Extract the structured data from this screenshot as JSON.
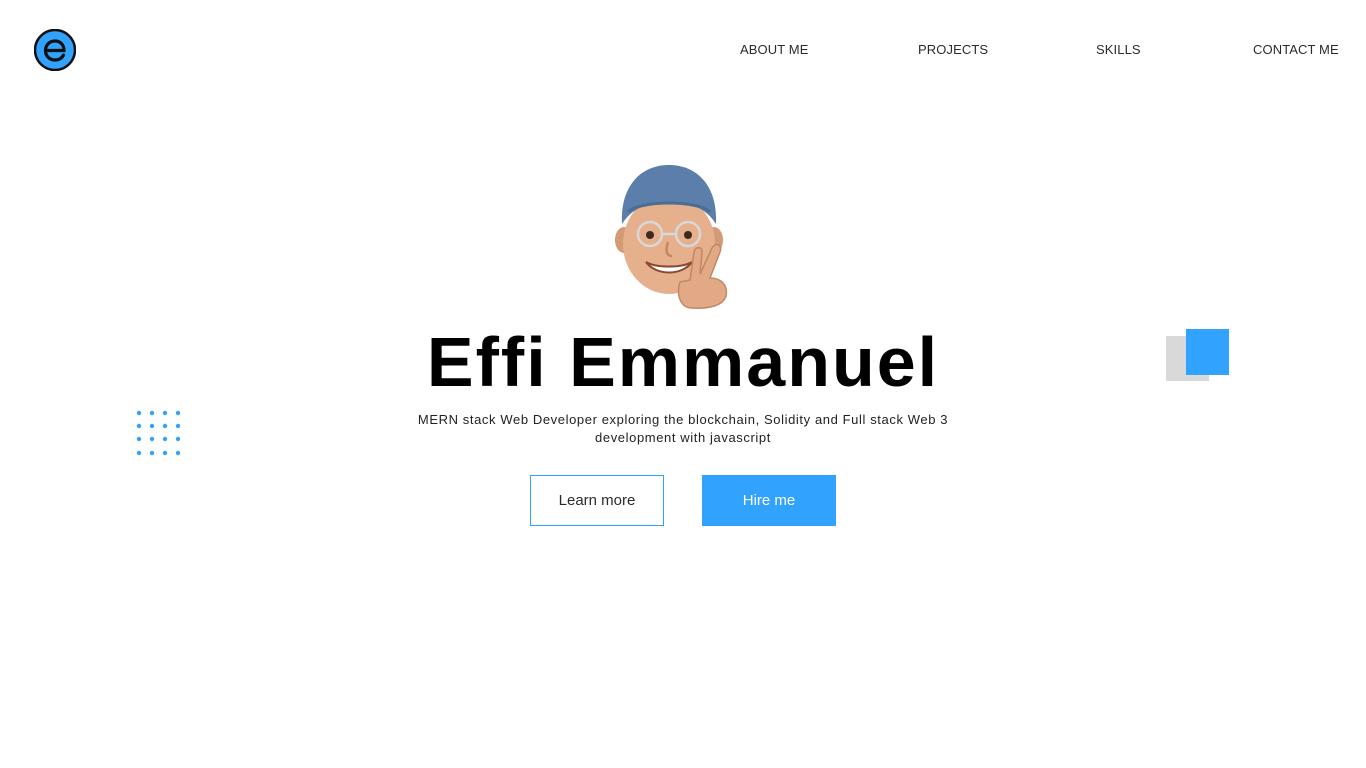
{
  "header": {
    "logo_icon": "letter-e-logo-icon",
    "nav": [
      {
        "label": "ABOUT ME"
      },
      {
        "label": "PROJECTS"
      },
      {
        "label": "SKILLS"
      },
      {
        "label": "CONTACT ME"
      }
    ]
  },
  "hero": {
    "avatar_icon": "memoji-peace-sign-avatar",
    "name": "Effi Emmanuel",
    "description": "MERN stack Web Developer exploring the blockchain, Solidity and Full stack Web 3 development with javascript",
    "learn_more_label": "Learn more",
    "hire_me_label": "Hire me"
  },
  "colors": {
    "accent": "#31a3fe",
    "logo_ring": "#111111",
    "square_grey": "#d9d9d9",
    "text": "#000000"
  }
}
